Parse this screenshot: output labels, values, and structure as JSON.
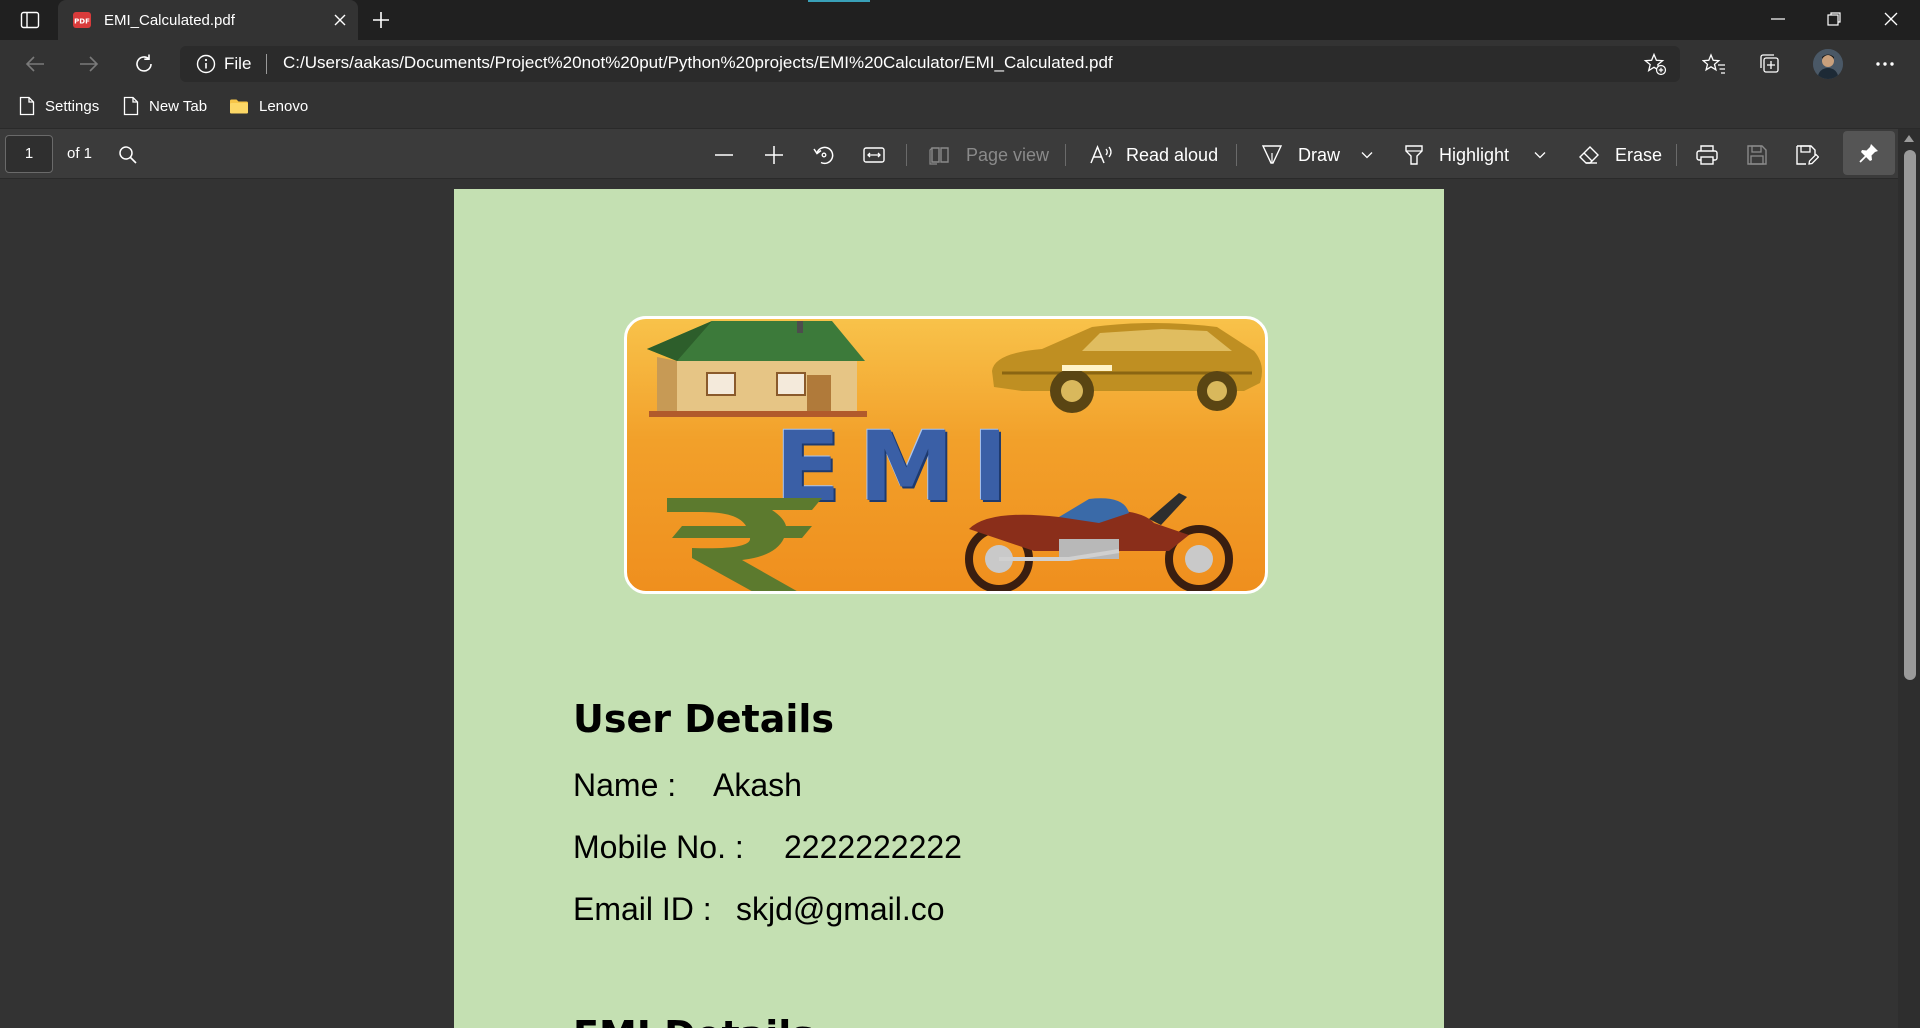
{
  "browser": {
    "tab": {
      "title": "EMI_Calculated.pdf"
    },
    "address_bar": {
      "site_info_label": "File",
      "url": "C:/Users/aakas/Documents/Project%20not%20put/Python%20projects/EMI%20Calculator/EMI_Calculated.pdf"
    },
    "favorites": [
      {
        "label": "Settings",
        "icon": "page-icon"
      },
      {
        "label": "New Tab",
        "icon": "page-icon"
      },
      {
        "label": "Lenovo",
        "icon": "folder-icon"
      }
    ]
  },
  "pdf_toolbar": {
    "page_number": "1",
    "page_of": "of 1",
    "page_view_label": "Page view",
    "read_aloud_label": "Read aloud",
    "draw_label": "Draw",
    "highlight_label": "Highlight",
    "erase_label": "Erase"
  },
  "document": {
    "banner_text": "EMI",
    "user_details_heading": "User Details",
    "name_label": "Name :",
    "name_value": "Akash",
    "mobile_label": "Mobile No. :",
    "mobile_value": "2222222222",
    "email_label": "Email ID :",
    "email_value": "skjd@gmail.co",
    "emi_details_heading": "EMI Details"
  },
  "colors": {
    "page_background": "#c4e0b2",
    "viewer_background": "#333333",
    "banner_orange": "#f2a02a",
    "banner_text_blue": "#3a5fa6"
  }
}
